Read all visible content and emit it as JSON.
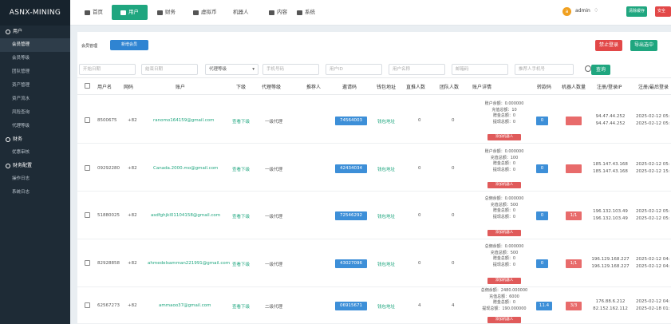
{
  "brand": "ASNX-MINING",
  "sidebar": {
    "groups": [
      {
        "label": "用户",
        "items": [
          "会员管理",
          "会员等级",
          "团队管理",
          "资产管理",
          "资产流水",
          "风险查询",
          "代理等级"
        ]
      },
      {
        "label": "财务",
        "items": [
          "优惠审核"
        ]
      },
      {
        "label": "财务配置",
        "items": [
          "操作日志",
          "系统日志"
        ]
      }
    ]
  },
  "topnav": {
    "items": [
      {
        "label": "首页",
        "icon": "home-icon"
      },
      {
        "label": "用户",
        "icon": "user-icon"
      },
      {
        "label": "财务",
        "icon": "finance-icon"
      },
      {
        "label": "虚拟币",
        "icon": "coin-icon"
      },
      {
        "label": "机器人",
        "icon": ""
      },
      {
        "label": "内容",
        "icon": "content-icon"
      },
      {
        "label": "系统",
        "icon": "gear-icon"
      }
    ],
    "avatar_letter": "a",
    "username": "admin",
    "clear_cache": "清除缓存",
    "logout": "安全退出"
  },
  "page": {
    "breadcrumb": "会员管理",
    "add_button": "新增会员",
    "ban_button": "禁止登录",
    "export_button": "导出选中"
  },
  "filters": {
    "start_date": "开始日期",
    "end_date": "结束日期",
    "agent_level": "代理等级",
    "phone": "手机号码",
    "user_id": "用户ID",
    "username": "用户名称",
    "email": "邮箱码",
    "referrer_phone": "推荐人手机号",
    "search": "查询"
  },
  "columns": [
    "用户名",
    "网码",
    "账户",
    "下级",
    "代理等级",
    "推荐人",
    "邀请码",
    "钱包地址",
    "直推人数",
    "团队人数",
    "账户详情",
    "转款码",
    "机器人数量",
    "注册/登录IP",
    "注册/最后登录"
  ],
  "rows": [
    {
      "username": "8500675",
      "code": "+82",
      "account": "ranomo164159@gmail.com",
      "sub": "查看下级",
      "level": "一级代理",
      "invite": "74564003",
      "wallet": "钱包地址",
      "direct": "0",
      "team": "0",
      "detail": [
        "账户余额：0.000000",
        "充值总额：10",
        "赠金总额：0",
        "提现总额：0"
      ],
      "robot_btn": "添加机器人",
      "transfer": "0",
      "robots": "",
      "ip1": "94.47.44.252",
      "ip2": "94.47.44.252",
      "t1": "2025-02-12 05:",
      "t2": "2025-02-12 05:"
    },
    {
      "username": "09292280",
      "code": "+82",
      "account": "Canada.2000.mo@gmail.com",
      "sub": "查看下级",
      "level": "一级代理",
      "invite": "42434034",
      "wallet": "钱包地址",
      "direct": "0",
      "team": "0",
      "detail": [
        "账户余额：0.000000",
        "充值总额：100",
        "赠金总额：0",
        "提现总额：0"
      ],
      "robot_btn": "添加机器人",
      "transfer": "0",
      "robots": "",
      "ip1": "185.147.43.168",
      "ip2": "185.147.43.168",
      "t1": "2025-02-12 05:",
      "t2": "2025-02-12 15:"
    },
    {
      "username": "51880025",
      "code": "+82",
      "account": "asdfghjkl01104158@gmail.com",
      "sub": "查看下级",
      "level": "一级代理",
      "invite": "72546292",
      "wallet": "钱包地址",
      "direct": "0",
      "team": "0",
      "detail": [
        "总佣余额：0.000000",
        "充值总额：500",
        "赠金总额：0",
        "提现总额：0"
      ],
      "robot_btn": "添加机器人",
      "transfer": "0",
      "robots": "1/1",
      "ip1": "196.132.103.49",
      "ip2": "196.132.103.49",
      "t1": "2025-02-12 05:",
      "t2": "2025-02-12 05:"
    },
    {
      "username": "82928858",
      "code": "+82",
      "account": "ahmedelsamman221991@gmail.com",
      "sub": "查看下级",
      "level": "一级代理",
      "invite": "43027096",
      "wallet": "钱包地址",
      "direct": "0",
      "team": "0",
      "detail": [
        "总佣余额：0.000000",
        "充值总额：500",
        "赠金总额：0",
        "提现总额：0"
      ],
      "robot_btn": "添加机器人",
      "transfer": "0",
      "robots": "1/1",
      "ip1": "196.129.168.227",
      "ip2": "196.129.168.227",
      "t1": "2025-02-12 04:",
      "t2": "2025-02-12 04:"
    },
    {
      "username": "62567273",
      "code": "+82",
      "account": "ammaoo37@gmail.com",
      "sub": "查看下级",
      "level": "二级代理",
      "invite": "06915671",
      "wallet": "钱包地址",
      "direct": "4",
      "team": "4",
      "detail": [
        "总佣余额：2480.000000",
        "充值总额：6000",
        "赠金总额：0",
        "提现总额：190.000000"
      ],
      "robot_btn": "添加机器人",
      "transfer": "11.4",
      "robots": "3/3",
      "ip1": "176.88.6.212",
      "ip2": "82.152.162.112",
      "t1": "2025-02-12 04:",
      "t2": "2025-02-18 01:"
    }
  ]
}
